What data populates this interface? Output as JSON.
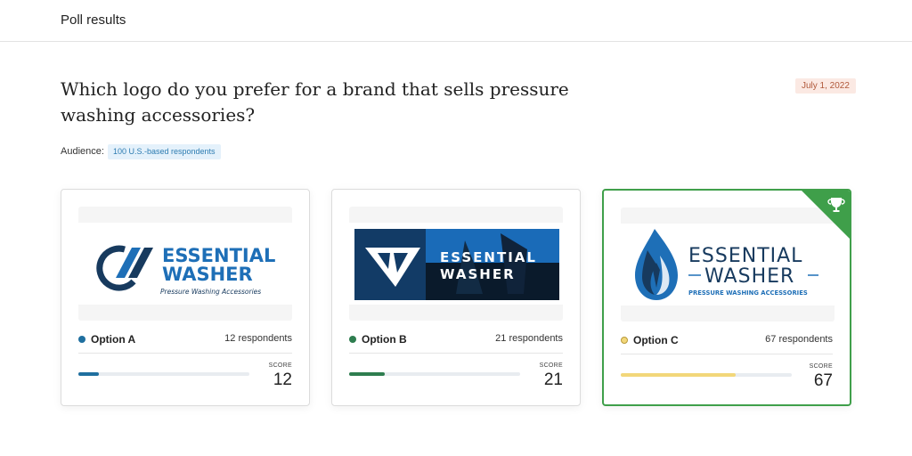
{
  "header": {
    "title": "Poll results"
  },
  "poll": {
    "question": "Which logo do you prefer for a brand that sells pressure washing accessories?",
    "date": "July 1, 2022",
    "audience_label": "Audience:",
    "audience_value": "100 U.S.-based respondents"
  },
  "score_label": "SCORE",
  "options": [
    {
      "name": "Option A",
      "respondents": "12 respondents",
      "score": "12",
      "share": 0.12,
      "color": "#1f6f9f",
      "logo": {
        "brand_line1": "ESSENTIAL",
        "brand_line2": "WASHER",
        "tagline": "Pressure Washing Accessories"
      }
    },
    {
      "name": "Option B",
      "respondents": "21 respondents",
      "score": "21",
      "share": 0.21,
      "color": "#2e7d4f",
      "logo": {
        "brand_line1": "ESSENTIAL",
        "brand_line2": "WASHER"
      }
    },
    {
      "name": "Option C",
      "respondents": "67 respondents",
      "score": "67",
      "share": 0.67,
      "color": "#f2d77a",
      "winner": true,
      "logo": {
        "brand_line1": "ESSENTIAL",
        "brand_line2": "WASHER",
        "tagline": "PRESSURE WASHING ACCESSORIES"
      }
    }
  ],
  "colors": {
    "brand_navy": "#173a5e",
    "logo_blue": "#1e6fb7",
    "winner_green": "#3f9f4a"
  }
}
